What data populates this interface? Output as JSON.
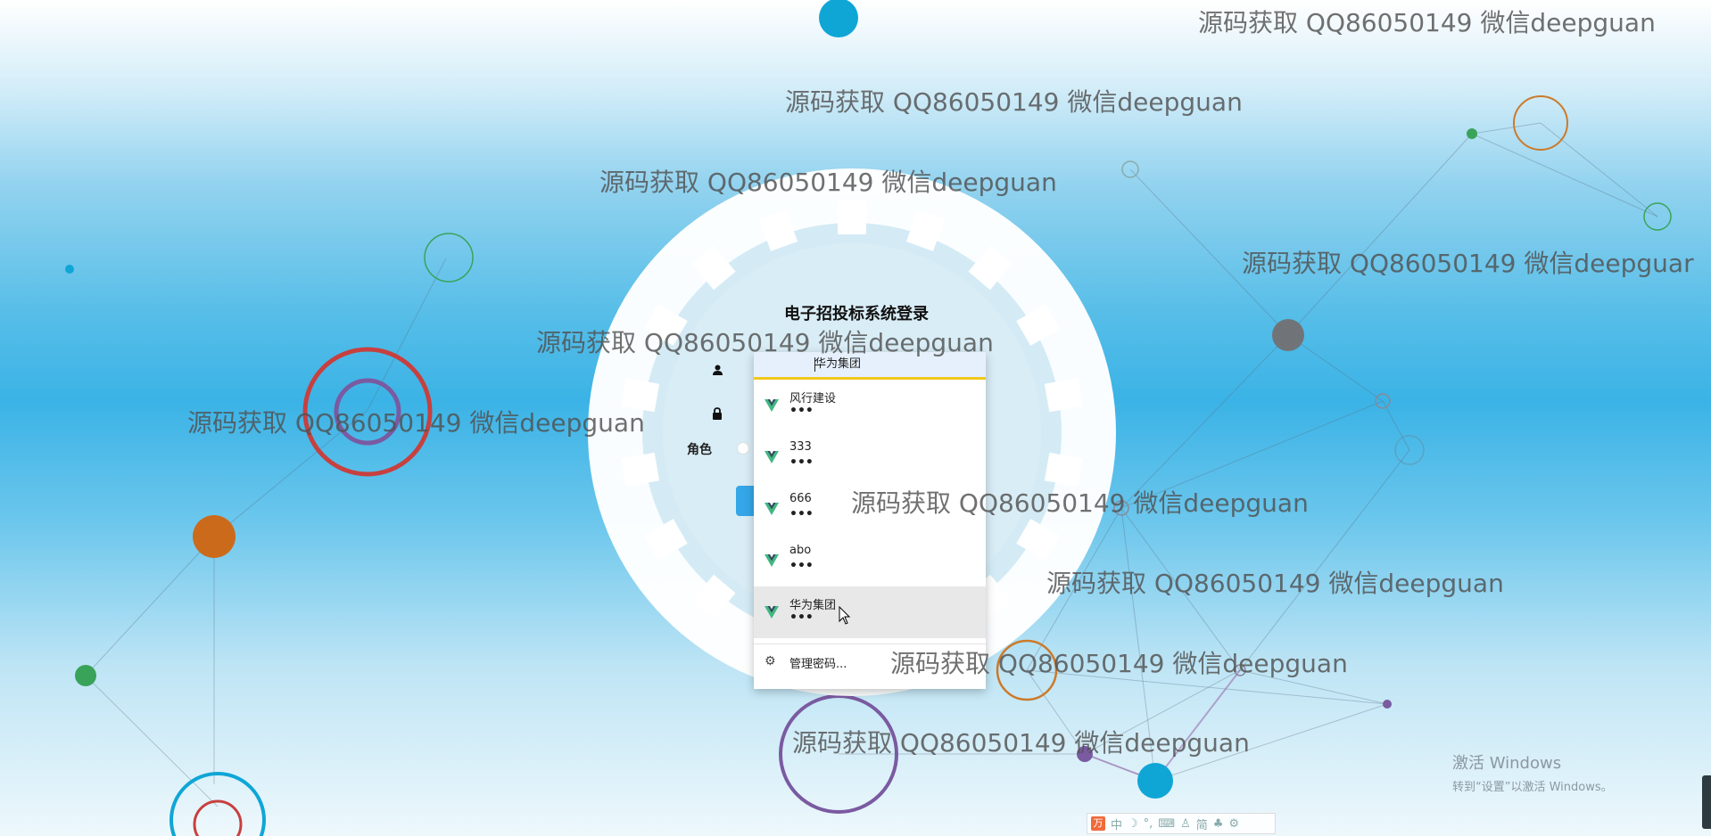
{
  "login": {
    "title": "电子招投标系统登录",
    "role_label": "角色",
    "username_value": "华为集团"
  },
  "autofill": {
    "items": [
      {
        "name": "风行建设",
        "password_mask": "•••"
      },
      {
        "name": "333",
        "password_mask": "•••"
      },
      {
        "name": "666",
        "password_mask": "•••"
      },
      {
        "name": "abo",
        "password_mask": "•••"
      },
      {
        "name": "华为集团",
        "password_mask": "•••"
      }
    ],
    "manage_label": "管理密码..."
  },
  "watermark": {
    "text": "源码获取 QQ86050149 微信deepguan",
    "truncated_text": "源码获取 QQ86050149 微信deepguar"
  },
  "windows_activation": {
    "title": "激活 Windows",
    "subtitle": "转到“设置”以激活 Windows。"
  },
  "ime_toolbar": {
    "logo": "万",
    "mode": "中",
    "traditional": "简"
  },
  "colors": {
    "accent_blue": "#35a6e8",
    "input_highlight": "#f2c81b",
    "vue_green": "#41b883",
    "vue_dark": "#35495e"
  }
}
